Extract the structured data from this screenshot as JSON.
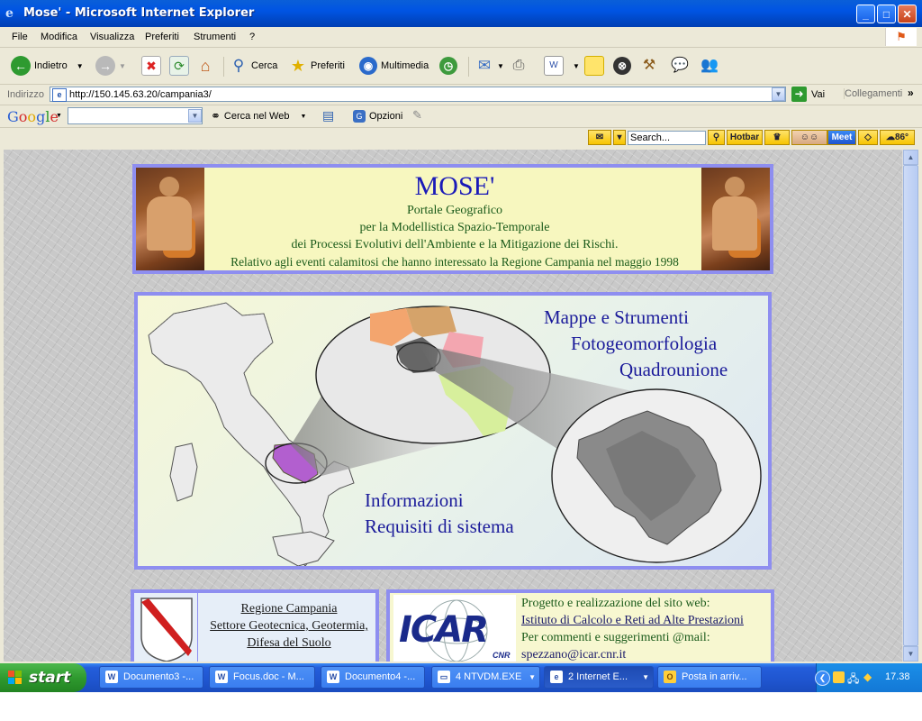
{
  "window": {
    "title": "Mose' - Microsoft Internet Explorer",
    "min": "_",
    "max": "□",
    "close": "✕"
  },
  "menu": [
    "File",
    "Modifica",
    "Visualizza",
    "Preferiti",
    "Strumenti",
    "?"
  ],
  "toolbar": {
    "back_label": "Indietro",
    "search_label": "Cerca",
    "favorites_label": "Preferiti",
    "media_label": "Multimedia"
  },
  "address": {
    "label": "Indirizzo",
    "url": "http://150.145.63.20/campania3/",
    "go_label": "Vai",
    "links_label": "Collegamenti",
    "more": "»"
  },
  "google": {
    "logo": "Google",
    "search_web_label": "Cerca nel Web",
    "options_label": "Opzioni"
  },
  "hotbar": {
    "search_value": "Search...",
    "hotbar_label": "Hotbar",
    "meet_label": "Meet",
    "temp": "86°"
  },
  "banner": {
    "title": "MOSE'",
    "line1": "Portale Geografico",
    "line2": "per la Modellistica Spazio-Temporale",
    "line3": "dei Processi Evolutivi dell'Ambiente e la Mitigazione dei Rischi.",
    "line4": "Relativo agli eventi calamitosi che hanno interessato la Regione Campania nel maggio 1998"
  },
  "map_links": {
    "mappe": "Mappe e Strumenti",
    "foto": "Fotogeomorfologia",
    "quadro": "Quadrounione",
    "info": "Informazioni",
    "requisiti": "Requisiti di sistema"
  },
  "left_box": {
    "line1": "Regione Campania",
    "line2": "Settore Geotecnica, Geotermia,",
    "line3": "Difesa del Suolo"
  },
  "right_box": {
    "logo_text": "ICAR",
    "logo_sub": "CNR",
    "line1": "Progetto e realizzazione del sito web:",
    "line2": "Istituto di Calcolo e Reti ad Alte Prestazioni",
    "line3": "Per commenti e suggerimenti @mail:",
    "line4": "spezzano@icar.cnr.it"
  },
  "taskbar": {
    "start_label": "start",
    "tasks": [
      {
        "label": "Documento3 -...",
        "icon": "W"
      },
      {
        "label": "Focus.doc - M...",
        "icon": "W"
      },
      {
        "label": "Documento4 -...",
        "icon": "W"
      },
      {
        "label": "4 NTVDM.EXE",
        "icon": "▭"
      },
      {
        "label": "2 Internet E...",
        "icon": "e"
      },
      {
        "label": "Posta in arriv...",
        "icon": "O"
      }
    ],
    "clock": "17.38"
  },
  "colors": {
    "border_blue": "#8e8ef0",
    "banner_bg": "#f7f7bf",
    "link_blue": "#1a1a9a",
    "text_green": "#1a5a1a"
  }
}
